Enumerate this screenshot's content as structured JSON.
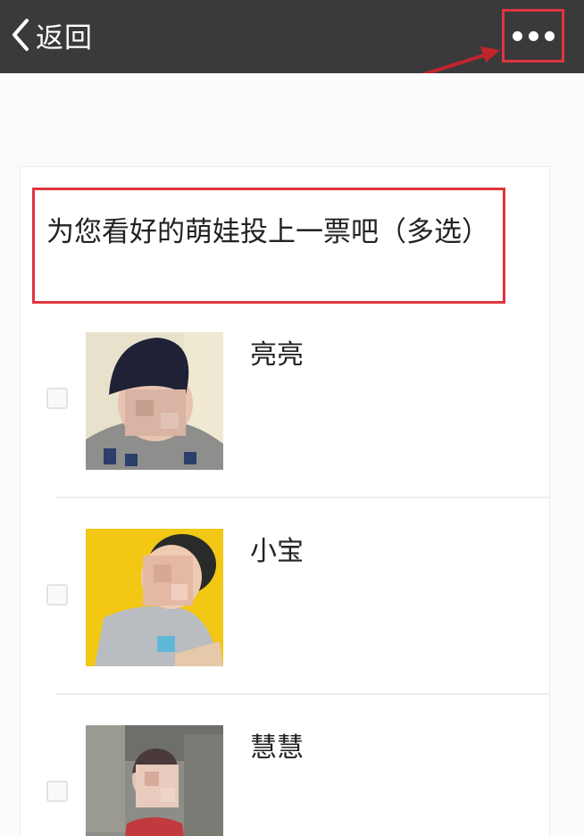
{
  "navbar": {
    "back_label": "返回",
    "back_icon": "chevron-left-icon",
    "more_icon": "more-dots-icon"
  },
  "colors": {
    "navbar": "#3a3a3c",
    "highlight": "#e0353d"
  },
  "poll": {
    "question": "为您看好的萌娃投上一票吧（多选）",
    "options": [
      {
        "label": "亮亮",
        "checked": false
      },
      {
        "label": "小宝",
        "checked": false
      },
      {
        "label": "慧慧",
        "checked": false
      }
    ]
  }
}
